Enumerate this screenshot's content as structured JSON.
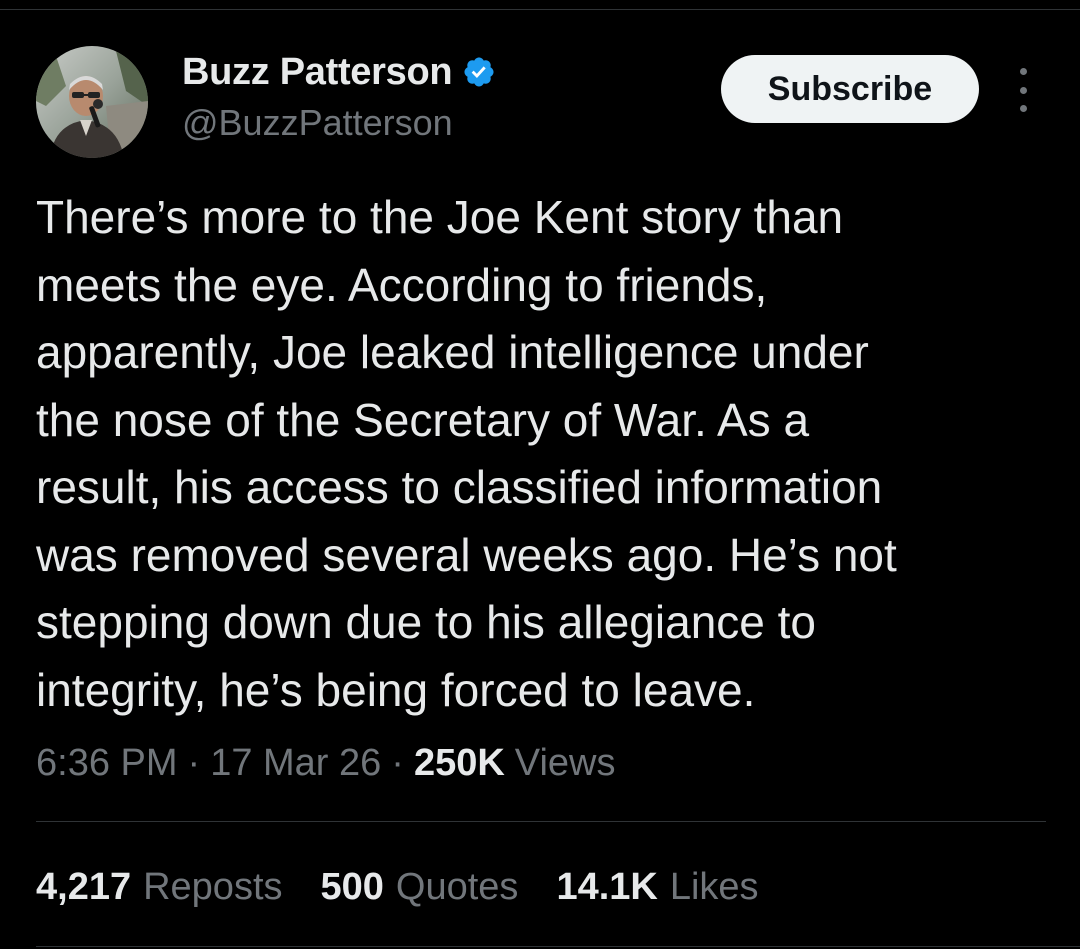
{
  "author": {
    "display_name": "Buzz Patterson",
    "handle": "@BuzzPatterson",
    "verified": true,
    "verified_color": "#1d9bf0"
  },
  "actions": {
    "subscribe_label": "Subscribe",
    "more_icon": "more-vertical-icon"
  },
  "tweet": {
    "lines": [
      "There’s more to the Joe Kent story than",
      "meets the eye. According to friends,",
      "apparently, Joe leaked intelligence under",
      "the nose of the Secretary of War. As a",
      "result, his access to classified information",
      "was removed several weeks ago. He’s not",
      "stepping down due to his allegiance to",
      "integrity, he’s being forced to leave."
    ]
  },
  "meta": {
    "time": "6:36 PM",
    "separator": "·",
    "date": "17 Mar 26",
    "views_count": "250K",
    "views_label": "Views"
  },
  "stats": {
    "reposts_count": "4,217",
    "reposts_label": "Reposts",
    "quotes_count": "500",
    "quotes_label": "Quotes",
    "likes_count": "14.1K",
    "likes_label": "Likes"
  },
  "colors": {
    "background": "#000000",
    "primary_text": "#e7e9ea",
    "secondary_text": "#71767b",
    "divider": "#2f3336",
    "button_bg": "#eff3f4"
  }
}
